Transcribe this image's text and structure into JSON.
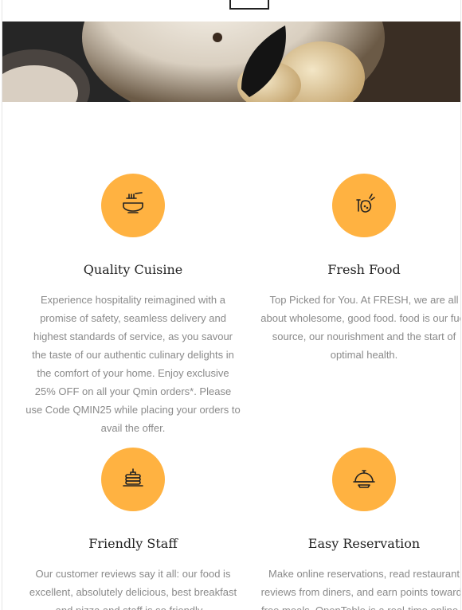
{
  "features": [
    {
      "title": "Quality Cuisine",
      "icon": "noodle-bowl-icon",
      "description": "Experience hospitality reimagined with a promise of safety, seamless delivery and highest standards of service, as you savour the taste of our authentic culinary delights in the comfort of your home. Enjoy exclusive 25% OFF on all your Qmin orders*. Please use Code QMIN25 while placing your orders to avail the offer."
    },
    {
      "title": "Fresh Food",
      "icon": "vegetables-icon",
      "description": "Top Picked for You. At FRESH, we are all about wholesome, good food. food is our fuel source, our nourishment and the start of optimal health."
    },
    {
      "title": "Friendly Staff",
      "icon": "pancakes-icon",
      "description": "Our customer reviews say it all: our food is excellent, absolutely delicious, best breakfast and pizza and staff is so friendly..."
    },
    {
      "title": "Easy Reservation",
      "icon": "serving-dish-icon",
      "description": "Make online reservations, read restaurant reviews from diners, and earn points towards free meals. OpenTable is a real-time online..."
    }
  ],
  "colors": {
    "accent": "#ffb241",
    "heading": "#222222",
    "body_text": "#8a8a8a"
  }
}
